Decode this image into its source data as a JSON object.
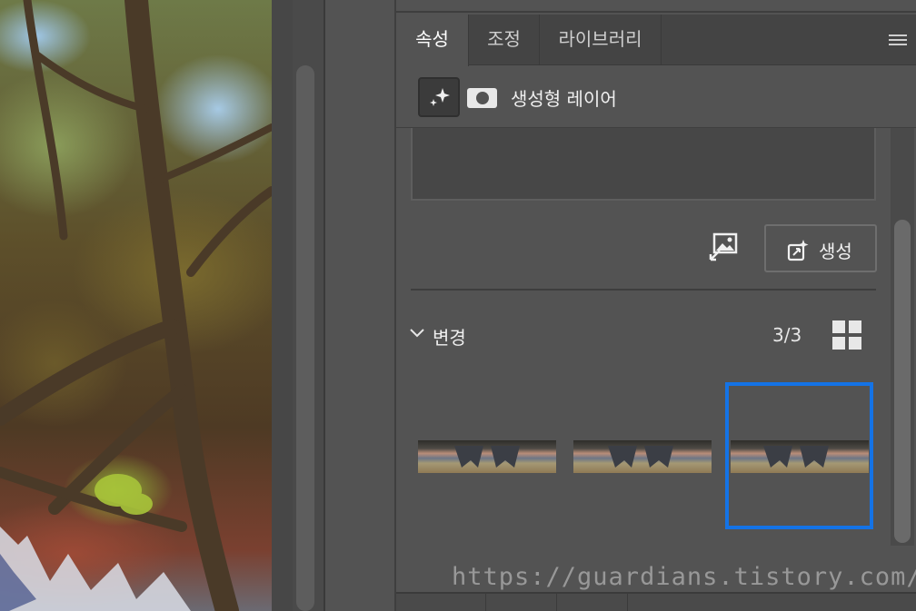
{
  "tabs": [
    {
      "label": "속성",
      "active": true
    },
    {
      "label": "조정",
      "active": false
    },
    {
      "label": "라이브러리",
      "active": false
    }
  ],
  "panel_menu_icon": "hamburger-menu-icon",
  "layer": {
    "title": "생성형 레이어",
    "icon": "generative-sparkle-icon",
    "mask_icon": "layer-mask-icon"
  },
  "prompt_value": "",
  "reference_image_icon": "reference-image-icon",
  "generate_button": {
    "label": "생성",
    "icon": "generate-sparkle-icon"
  },
  "variations": {
    "title": "변경",
    "count": "3/3",
    "view_icon": "grid-view-icon",
    "selected_index": 3,
    "thumbnail_count": 3
  },
  "watermark": "https://guardians.tistory.com/",
  "colors": {
    "selection": "#1473e6",
    "panel_bg": "#535353",
    "tab_bar_bg": "#444444"
  }
}
